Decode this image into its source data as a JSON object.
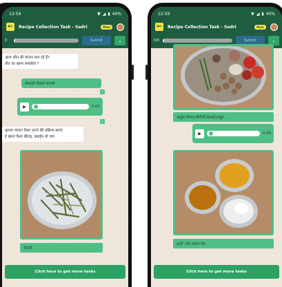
{
  "colors": {
    "primary": "#1e5d3f",
    "accent": "#4fbf85",
    "badge": "#f2e34a",
    "submit": "#2b6c8d"
  },
  "left_screen": {
    "status": {
      "time": "12:59",
      "battery": "40%"
    },
    "appbar": {
      "title": "Recipe Collection Task - Sadri",
      "badge": "Main"
    },
    "progress": {
      "count": "0",
      "fraction": 0.02,
      "submit_label": "Submit"
    },
    "question_1": "आज कौन सी व्यंजन बना रहे हैं?\nतोए का खाना बनाबोल ?",
    "answer_1": "सेमल्ली दिखान बनावो",
    "audio_time": "0:01",
    "question_2": "कृपया व्यंजन तैयार करने की प्रक्रिया बताएं\nई खाना कैसा बीटाइ, बताईन तो जरा",
    "photo_caption": "सेमली",
    "more_tasks": "Click here to get more tasks"
  },
  "right_screen": {
    "status": {
      "time": "12:59",
      "battery": "40%"
    },
    "appbar": {
      "title": "Recipe Collection Task - Sadri",
      "badge": "Main"
    },
    "progress": {
      "count": "0/6",
      "fraction": 0.02,
      "submit_label": "Submit"
    },
    "caption_1": "अलुवा,पेयाज,बीमीर्ची,बरवाई,लसुन,",
    "audio_time": "0:04",
    "caption_2": "हरदी ,नोन,सरसा तेल",
    "more_tasks": "Click here to get more tasks"
  }
}
